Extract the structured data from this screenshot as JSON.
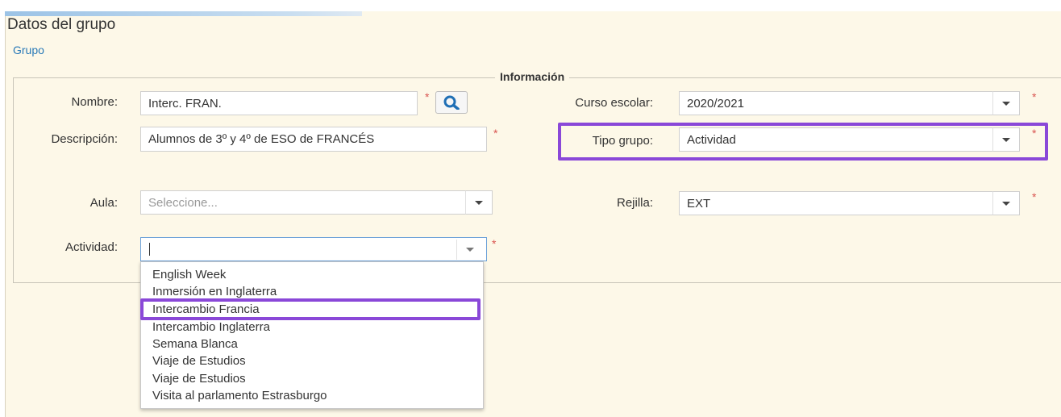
{
  "header": {
    "title": "Datos del grupo",
    "group_link": "Grupo"
  },
  "section": {
    "legend": "Información"
  },
  "left": {
    "nombre": {
      "label": "Nombre:",
      "value": "Interc. FRAN."
    },
    "descripcion": {
      "label": "Descripción:",
      "value": "Alumnos de 3º y 4º de ESO de FRANCÉS"
    },
    "aula": {
      "label": "Aula:",
      "placeholder": "Seleccione..."
    },
    "actividad": {
      "label": "Actividad:",
      "value": ""
    }
  },
  "right": {
    "curso": {
      "label": "Curso escolar:",
      "value": "2020/2021"
    },
    "tipo": {
      "label": "Tipo grupo:",
      "value": "Actividad"
    },
    "rejilla": {
      "label": "Rejilla:",
      "value": "EXT"
    }
  },
  "required_mark": "*",
  "dropdown": {
    "options": [
      "English Week",
      "Inmersión en Inglaterra",
      "Intercambio Francia",
      "Intercambio Inglaterra",
      "Semana Blanca",
      "Viaje de Estudios",
      "Viaje de Estudios",
      "Visita al parlamento Estrasburgo"
    ],
    "highlighted": "Intercambio Francia"
  },
  "colors": {
    "highlight": "#8a48d8",
    "required": "#d9534f",
    "link": "#2a7ab8",
    "panel_bg": "#fdf8e8"
  },
  "icons": {
    "search": "search-icon",
    "caret": "chevron-down-icon"
  }
}
